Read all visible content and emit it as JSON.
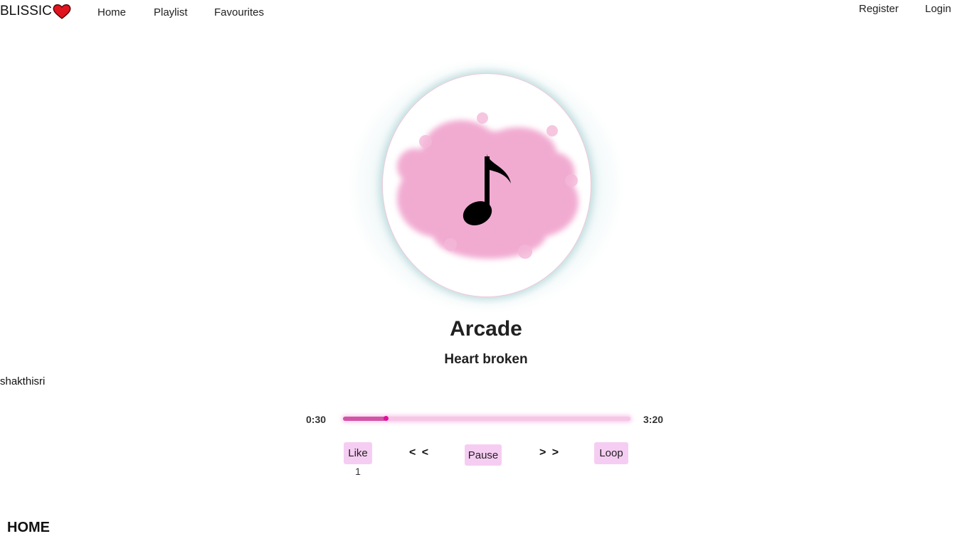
{
  "navbar": {
    "brand": "BLISSIC",
    "brand_icon": "heart-icon",
    "links": [
      "Home",
      "Playlist",
      "Favourites"
    ],
    "register": "Register",
    "login": "Login"
  },
  "player": {
    "art_icon": "music-note-icon",
    "title": "Arcade",
    "subtitle": "Heart broken",
    "uploader": "shakthisri",
    "current_time": "0:30",
    "total_time": "3:20",
    "progress_fraction": 0.15,
    "like_label": "Like",
    "like_count": "1",
    "prev_label": "< <",
    "pause_label": "Pause",
    "next_label": "> >",
    "loop_label": "Loop"
  },
  "section": {
    "heading": "HOME"
  },
  "colors": {
    "accent": "#d254a6",
    "button_bg": "#f6cdf2",
    "heart": "#e0141e"
  }
}
